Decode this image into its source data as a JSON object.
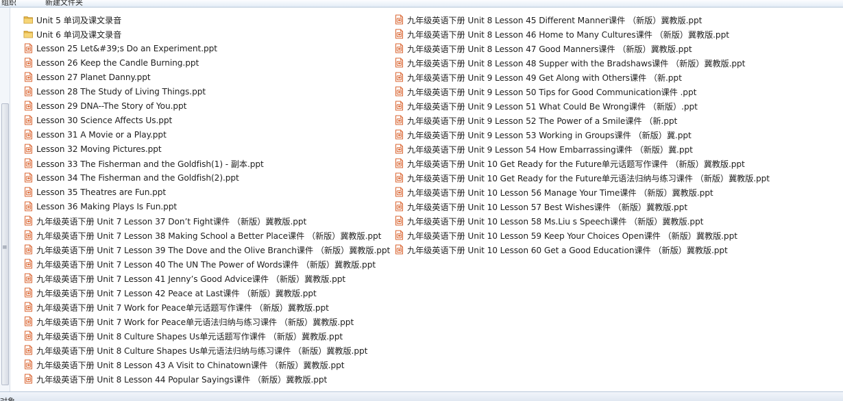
{
  "toolbar": {
    "items": [
      "组织",
      "新建文件夹"
    ]
  },
  "status": {
    "text": "对象"
  },
  "files": {
    "left": [
      {
        "name": "Unit 5 单词及课文录音",
        "icon": "folder-icon"
      },
      {
        "name": "Unit 6 单词及课文录音",
        "icon": "folder-icon"
      },
      {
        "name": "Lesson 25 Let&#39;s Do an Experiment.ppt",
        "icon": "ppt-file-icon"
      },
      {
        "name": "Lesson 26 Keep the Candle Burning.ppt",
        "icon": "ppt-file-icon"
      },
      {
        "name": "Lesson 27 Planet Danny.ppt",
        "icon": "ppt-file-icon"
      },
      {
        "name": "Lesson 28 The Study of Living Things.ppt",
        "icon": "ppt-file-icon"
      },
      {
        "name": "Lesson 29 DNA--The Story of You.ppt",
        "icon": "ppt-file-icon"
      },
      {
        "name": "Lesson 30 Science Affects Us.ppt",
        "icon": "ppt-file-icon"
      },
      {
        "name": "Lesson 31 A Movie or a Play.ppt",
        "icon": "ppt-file-icon"
      },
      {
        "name": "Lesson 32 Moving Pictures.ppt",
        "icon": "ppt-file-icon"
      },
      {
        "name": "Lesson 33 The Fisherman and the Goldfish(1) - 副本.ppt",
        "icon": "ppt-file-icon"
      },
      {
        "name": "Lesson 34 The Fisherman and the Goldfish(2).ppt",
        "icon": "ppt-file-icon"
      },
      {
        "name": "Lesson 35 Theatres are Fun.ppt",
        "icon": "ppt-file-icon"
      },
      {
        "name": "Lesson 36 Making Plays Is Fun.ppt",
        "icon": "ppt-file-icon"
      },
      {
        "name": "九年级英语下册 Unit 7 Lesson 37 Don’t Fight课件 （新版）冀教版.ppt",
        "icon": "ppt-file-icon"
      },
      {
        "name": "九年级英语下册 Unit 7 Lesson 38 Making School a Better Place课件 （新版）冀教版.ppt",
        "icon": "ppt-file-icon"
      },
      {
        "name": "九年级英语下册 Unit 7 Lesson 39 The Dove and the Olive Branch课件 （新版）冀教版.ppt",
        "icon": "ppt-file-icon"
      },
      {
        "name": "九年级英语下册 Unit 7 Lesson 40 The UN The Power of Words课件 （新版）冀教版.ppt",
        "icon": "ppt-file-icon"
      },
      {
        "name": "九年级英语下册 Unit 7 Lesson 41 Jenny’s Good Advice课件 （新版）冀教版.ppt",
        "icon": "ppt-file-icon"
      },
      {
        "name": "九年级英语下册 Unit 7 Lesson 42 Peace at Last课件 （新版）冀教版.ppt",
        "icon": "ppt-file-icon"
      },
      {
        "name": "九年级英语下册 Unit 7 Work for Peace单元话题写作课件 （新版）冀教版.ppt",
        "icon": "ppt-file-icon"
      },
      {
        "name": "九年级英语下册 Unit 7 Work for Peace单元语法归纳与练习课件 （新版）冀教版.ppt",
        "icon": "ppt-file-icon"
      },
      {
        "name": "九年级英语下册 Unit 8 Culture Shapes Us单元话题写作课件 （新版）冀教版.ppt",
        "icon": "ppt-file-icon"
      },
      {
        "name": "九年级英语下册 Unit 8 Culture Shapes Us单元语法归纳与练习课件 （新版）冀教版.ppt",
        "icon": "ppt-file-icon"
      },
      {
        "name": "九年级英语下册 Unit 8 Lesson 43 A Visit to Chinatown课件 （新版）冀教版.ppt",
        "icon": "ppt-file-icon"
      },
      {
        "name": "九年级英语下册 Unit 8 Lesson 44 Popular Sayings课件 （新版）冀教版.ppt",
        "icon": "ppt-file-icon"
      }
    ],
    "right": [
      {
        "name": "九年级英语下册 Unit 8 Lesson 45 Different Manner课件 （新版）冀教版.ppt",
        "icon": "ppt-file-icon"
      },
      {
        "name": "九年级英语下册 Unit 8 Lesson 46 Home to Many Cultures课件 （新版）冀教版.ppt",
        "icon": "ppt-file-icon"
      },
      {
        "name": "九年级英语下册 Unit 8 Lesson 47 Good Manners课件 （新版）冀教版.ppt",
        "icon": "ppt-file-icon"
      },
      {
        "name": "九年级英语下册 Unit 8 Lesson 48 Supper with the Bradshaws课件 （新版）冀教版.ppt",
        "icon": "ppt-file-icon"
      },
      {
        "name": "九年级英语下册 Unit 9 Lesson 49 Get Along with Others课件 （新.ppt",
        "icon": "ppt-file-icon"
      },
      {
        "name": "九年级英语下册 Unit 9 Lesson 50 Tips for Good Communication课件 .ppt",
        "icon": "ppt-file-icon"
      },
      {
        "name": "九年级英语下册 Unit 9 Lesson 51 What Could Be Wrong课件 （新版）.ppt",
        "icon": "ppt-file-icon"
      },
      {
        "name": "九年级英语下册 Unit 9 Lesson 52 The Power of a Smile课件 （新.ppt",
        "icon": "ppt-file-icon"
      },
      {
        "name": "九年级英语下册 Unit 9 Lesson 53 Working in Groups课件 （新版）冀.ppt",
        "icon": "ppt-file-icon"
      },
      {
        "name": "九年级英语下册 Unit 9 Lesson 54 How Embarrassing课件 （新版）冀.ppt",
        "icon": "ppt-file-icon"
      },
      {
        "name": "九年级英语下册 Unit 10 Get Ready for the Future单元话题写作课件 （新版）冀教版.ppt",
        "icon": "ppt-file-icon"
      },
      {
        "name": "九年级英语下册 Unit 10 Get Ready for the Future单元语法归纳与练习课件 （新版）冀教版.ppt",
        "icon": "ppt-file-icon"
      },
      {
        "name": "九年级英语下册 Unit 10 Lesson 56 Manage Your Time课件 （新版）冀教版.ppt",
        "icon": "ppt-file-icon"
      },
      {
        "name": "九年级英语下册 Unit 10 Lesson 57 Best Wishes课件 （新版）冀教版.ppt",
        "icon": "ppt-file-icon"
      },
      {
        "name": "九年级英语下册 Unit 10 Lesson 58 Ms.Liu s Speech课件 （新版）冀教版.ppt",
        "icon": "ppt-file-icon"
      },
      {
        "name": "九年级英语下册 Unit 10 Lesson 59 Keep Your Choices Open课件 （新版）冀教版.ppt",
        "icon": "ppt-file-icon"
      },
      {
        "name": "九年级英语下册 Unit 10 Lesson 60 Get a Good Education课件 （新版）冀教版.ppt",
        "icon": "ppt-file-icon"
      }
    ]
  },
  "colors": {
    "folder": "#e8b94a",
    "ppt": "#d9632f"
  }
}
